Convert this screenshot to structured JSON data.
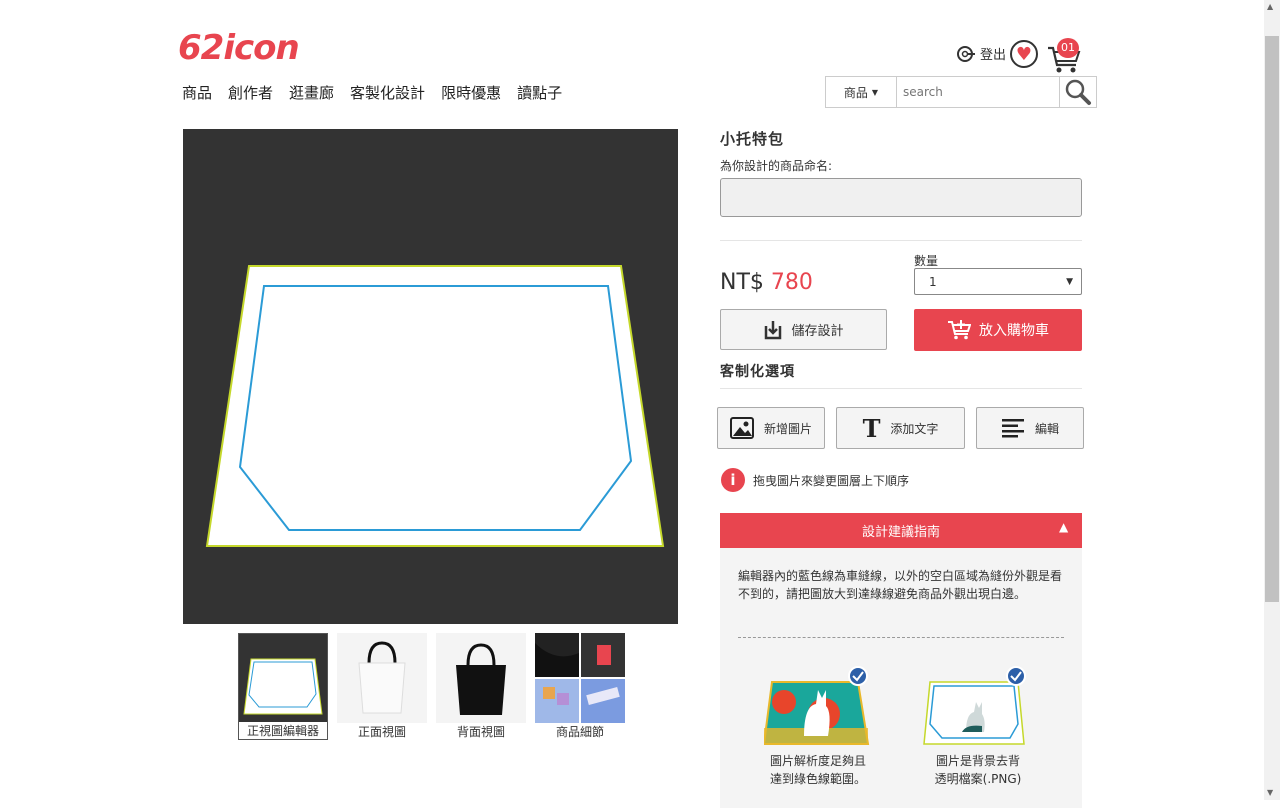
{
  "brand": {
    "logo_text": "62icon",
    "accent": "#e8454f"
  },
  "header": {
    "login_label": "登出",
    "cart_count": "01",
    "nav": [
      "商品",
      "創作者",
      "逛畫廊",
      "客製化設計",
      "限時優惠",
      "讀點子"
    ],
    "search": {
      "category": "商品",
      "placeholder": "search"
    }
  },
  "editor": {
    "background": "#333333",
    "safe_line_color": "#2b9bd6",
    "bleed_line_color": "#c5d82b"
  },
  "thumbs": [
    {
      "label": "正視圖編輯器",
      "active": true
    },
    {
      "label": "正面視圖",
      "active": false
    },
    {
      "label": "背面視圖",
      "active": false
    },
    {
      "label": "商品細節",
      "active": false
    }
  ],
  "product": {
    "title": "小托特包",
    "name_label": "為你設計的商品命名:",
    "name_value": "",
    "currency": "NT$",
    "price": "780",
    "qty_label": "數量",
    "qty_value": "1",
    "save_label": "儲存設計",
    "add_cart_label": "放入購物車"
  },
  "customize": {
    "title": "客制化選項",
    "tools": [
      "新增圖片",
      "添加文字",
      "編輯"
    ],
    "hint": "拖曳圖片來變更圖層上下順序"
  },
  "guide": {
    "title": "設計建議指南",
    "text": "編輯器內的藍色線為車縫線，以外的空白區域為縫份外觀是看不到的，請把圖放大到達綠線避免商品外觀出現白邊。",
    "items": [
      {
        "caption_line1": "圖片解析度足夠且",
        "caption_line2": "達到綠色線範圍。"
      },
      {
        "caption_line1": "圖片是背景去背",
        "caption_line2": "透明檔案(.PNG)"
      }
    ]
  }
}
